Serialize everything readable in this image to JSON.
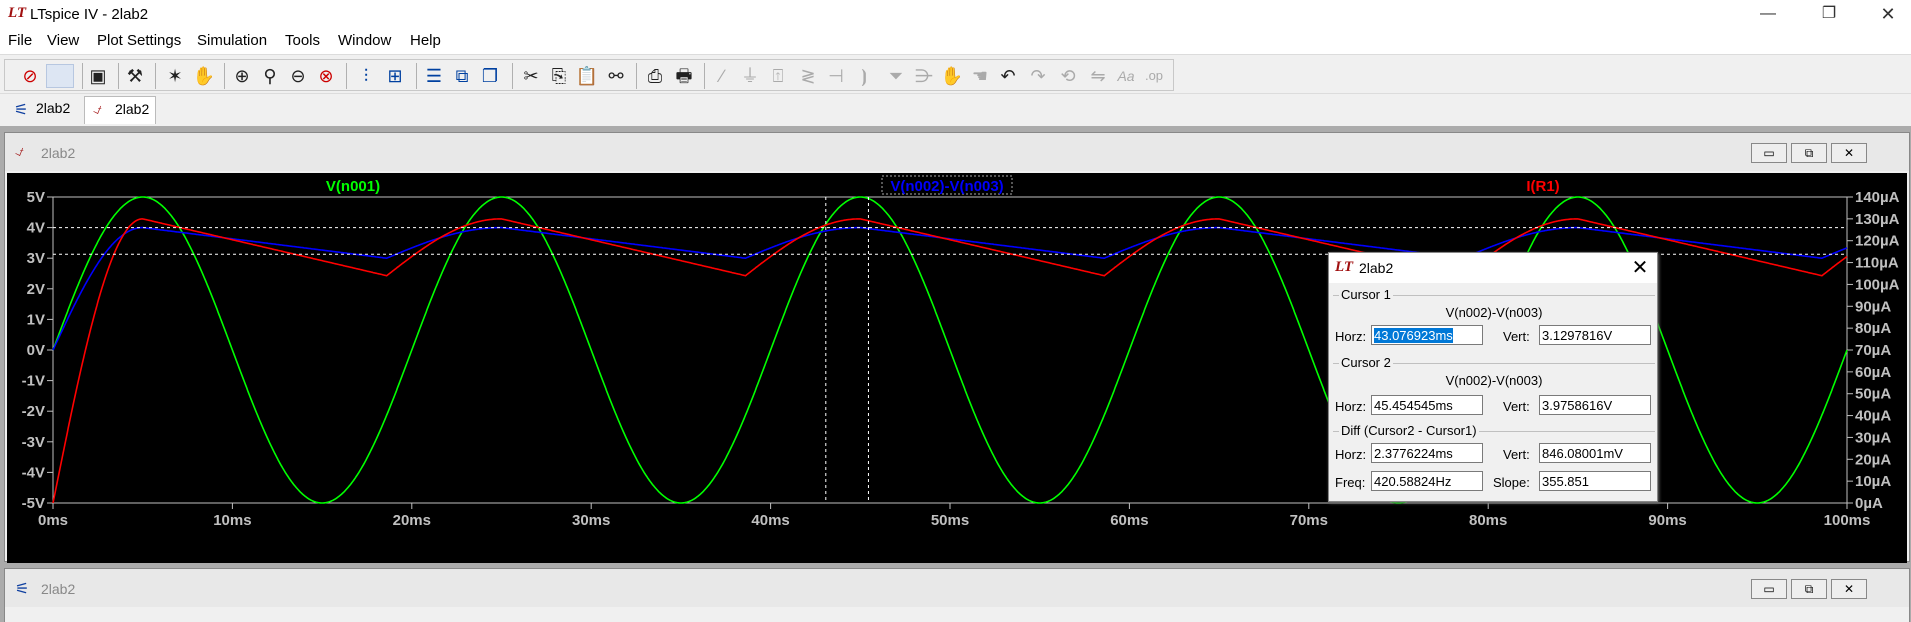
{
  "app": {
    "title": "LTspice IV - 2lab2",
    "logo": "LT"
  },
  "window_controls": {
    "minimize": "—",
    "maximize": "❐",
    "close": "✕"
  },
  "menu": [
    {
      "label": "File"
    },
    {
      "label": "View"
    },
    {
      "label": "Plot Settings"
    },
    {
      "label": "Simulation"
    },
    {
      "label": "Tools"
    },
    {
      "label": "Window"
    },
    {
      "label": "Help"
    }
  ],
  "toolbar": {
    "icons": [
      "new-schematic",
      "open",
      "save",
      "control-panel",
      "run",
      "halt",
      "zoom-in",
      "zoom-pan",
      "zoom-out",
      "zoom-fit",
      "autorange",
      "cursor-measure",
      "tile-horizontal",
      "tile-vertical",
      "cascade",
      "cut",
      "copy",
      "paste",
      "find",
      "print-preview",
      "print",
      "wire",
      "ground",
      "label",
      "resistor",
      "capacitor",
      "inductor",
      "diode",
      "component",
      "move",
      "drag",
      "undo",
      "redo",
      "rotate",
      "mirror",
      "text",
      "spice-directive"
    ]
  },
  "tabs": [
    {
      "label": "2lab2",
      "icon": "schematic-icon",
      "active": false
    },
    {
      "label": "2lab2",
      "icon": "waveform-icon",
      "active": true
    }
  ],
  "waveform_window": {
    "title": "2lab2"
  },
  "schematic_window": {
    "title": "2lab2"
  },
  "child_controls": {
    "minimize": "▭",
    "restore": "⧉",
    "close": "✕"
  },
  "chart_data": {
    "type": "line",
    "xlabel": "",
    "ylabel": "",
    "x_ticks": [
      "0ms",
      "10ms",
      "20ms",
      "30ms",
      "40ms",
      "50ms",
      "60ms",
      "70ms",
      "80ms",
      "90ms",
      "100ms"
    ],
    "xlim": [
      0,
      100
    ],
    "y_left_ticks": [
      "5V",
      "4V",
      "3V",
      "2V",
      "1V",
      "0V",
      "-1V",
      "-2V",
      "-3V",
      "-4V",
      "-5V"
    ],
    "ylim_left": [
      -5,
      5
    ],
    "y_right_ticks": [
      "140µA",
      "130µA",
      "120µA",
      "110µA",
      "100µA",
      "90µA",
      "80µA",
      "70µA",
      "60µA",
      "50µA",
      "40µA",
      "30µA",
      "20µA",
      "10µA",
      "0µA"
    ],
    "ylim_right": [
      0,
      140
    ],
    "series": [
      {
        "name": "V(n001)",
        "color": "#00ff00",
        "axis": "left",
        "kind": "sine",
        "amplitude": 5,
        "period_ms": 20
      },
      {
        "name": "V(n002)-V(n003)",
        "color": "#0000ff",
        "axis": "left",
        "kind": "ripple",
        "peak": 4.0,
        "valley": 3.0
      },
      {
        "name": "I(R1)",
        "color": "#ff0000",
        "axis": "right",
        "kind": "ripple",
        "peak_uA": 130,
        "valley_uA": 104
      }
    ],
    "cursors_ms": [
      43.076923,
      45.454545
    ]
  },
  "cursor_dialog": {
    "title": "2lab2",
    "close": "✕",
    "cursor1": {
      "label": "Cursor 1",
      "trace": "V(n002)-V(n003)",
      "horz_label": "Horz:",
      "horz": "43.076923ms",
      "vert_label": "Vert:",
      "vert": "3.1297816V"
    },
    "cursor2": {
      "label": "Cursor 2",
      "trace": "V(n002)-V(n003)",
      "horz_label": "Horz:",
      "horz": "45.454545ms",
      "vert_label": "Vert:",
      "vert": "3.9758616V"
    },
    "diff": {
      "label": "Diff (Cursor2 - Cursor1)",
      "horz_label": "Horz:",
      "horz": "2.3776224ms",
      "vert_label": "Vert:",
      "vert": "846.08001mV",
      "freq_label": "Freq:",
      "freq": "420.58824Hz",
      "slope_label": "Slope:",
      "slope": "355.851"
    }
  }
}
